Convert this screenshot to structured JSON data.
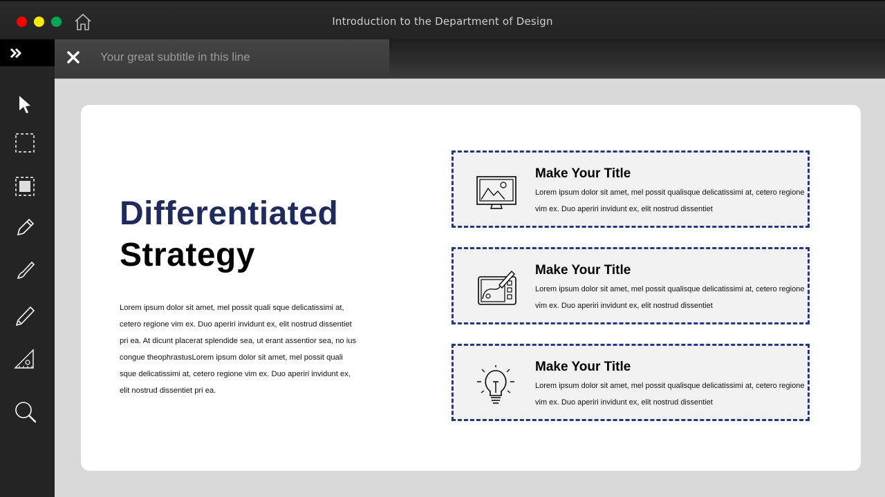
{
  "window": {
    "title": "Introduction to the Department of Design",
    "controls": [
      "close",
      "minimize",
      "maximize"
    ],
    "colors": {
      "close": "#ff0000",
      "minimize": "#ffea00",
      "maximize": "#00a651"
    },
    "home_icon": "home-icon"
  },
  "tab": {
    "subtitle": "Your great subtitle in this line",
    "close_icon": "close-icon"
  },
  "sidebar": {
    "expand_icon": "double-chevron-right-icon",
    "tools": [
      "pointer-icon",
      "marquee-select-icon",
      "frame-select-icon",
      "pencil-icon",
      "brush-icon",
      "pen-icon",
      "ruler-triangle-icon",
      "search-icon"
    ]
  },
  "slide": {
    "heading_line1": "Differentiated",
    "heading_line2": "Strategy",
    "body": "Lorem  ipsum dolor sit amet, mel  possit quali sque delicatissimi at, cetero  regione  vim ex.  Duo aperiri invidunt ex, elit nostrud dissentiet pri ea.  At  dicunt placerat splendide sea, ut erant assentior sea, no ius congue theophrastusLorem  ipsum dolor sit amet,  mel  possit quali sque delicatissimi at, cetero  regione  vim ex.  Duo aperiri invidunt ex,  elit nostrud dissentiet pri ea.",
    "accent_color": "#1f2a5e",
    "features": [
      {
        "icon": "image-monitor-icon",
        "title": "Make Your Title",
        "description": "Lorem  ipsum dolor sit amet, mel  possit qualisque delicatissimi at, cetero  regione vim ex.  Duo aperiri invidunt ex, elit nostrud dissentiet"
      },
      {
        "icon": "drawing-tablet-icon",
        "title": "Make Your Title",
        "description": "Lorem  ipsum dolor sit amet, mel  possit qualisque delicatissimi at, cetero  regione vim ex.  Duo aperiri invidunt ex, elit nostrud dissentiet"
      },
      {
        "icon": "lightbulb-icon",
        "title": "Make Your Title",
        "description": "Lorem  ipsum dolor sit amet, mel  possit qualisque delicatissimi at, cetero  regione vim ex.  Duo aperiri invidunt ex, elit nostrud dissentiet"
      }
    ]
  }
}
